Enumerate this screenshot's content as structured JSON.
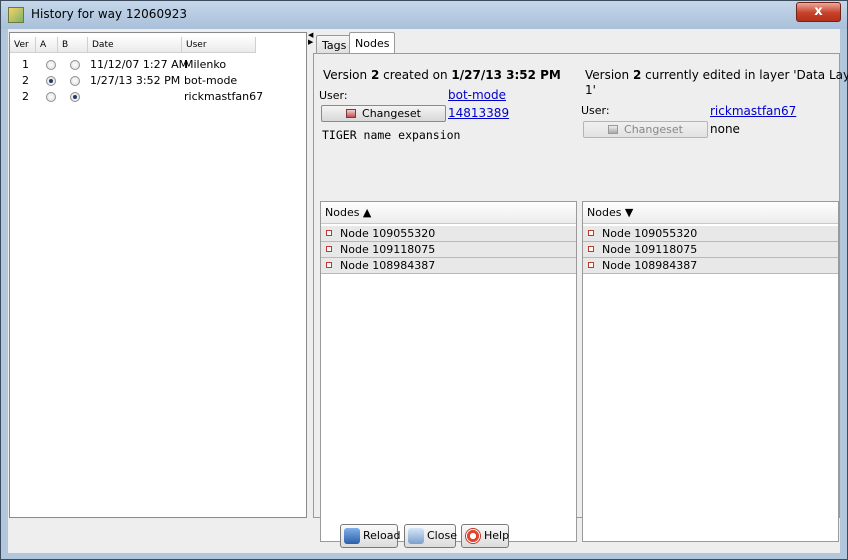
{
  "window": {
    "title": "History for way 12060923",
    "close_symbol": "x"
  },
  "history_table": {
    "columns": [
      "Ver",
      "A",
      "B",
      "Date",
      "User"
    ],
    "rows": [
      {
        "ver": "1",
        "a_selected": false,
        "b_selected": false,
        "date": "11/12/07 1:27 AM",
        "user": "Milenko"
      },
      {
        "ver": "2",
        "a_selected": true,
        "b_selected": false,
        "date": "1/27/13 3:52 PM",
        "user": "bot-mode"
      },
      {
        "ver": "2",
        "a_selected": false,
        "b_selected": true,
        "date": "",
        "user": "rickmastfan67"
      }
    ]
  },
  "tabs": [
    {
      "label": "Tags",
      "active": false
    },
    {
      "label": "Nodes",
      "active": true
    }
  ],
  "left_version": {
    "prefix": "Version ",
    "number": "2",
    "middle": " created on ",
    "date": "1/27/13 3:52 PM",
    "user_label": "User:",
    "user": "bot-mode",
    "changeset_button": "Changeset",
    "changeset_id": "14813389",
    "comment": "TIGER name expansion"
  },
  "right_version": {
    "prefix": "Version ",
    "number": "2",
    "suffix_line1": " currently edited in layer 'Data Layer",
    "suffix_line2": "1'",
    "user_label": "User:",
    "user": "rickmastfan67",
    "changeset_button": "Changeset",
    "changeset_id": "none"
  },
  "left_nodes": {
    "header": "Nodes ▲",
    "items": [
      "Node 109055320",
      "Node 109118075",
      "Node 108984387"
    ]
  },
  "right_nodes": {
    "header": "Nodes ▼",
    "items": [
      "Node 109055320",
      "Node 109118075",
      "Node 108984387"
    ]
  },
  "buttons": {
    "reload": "Reload",
    "close": "Close",
    "help": "Help"
  }
}
